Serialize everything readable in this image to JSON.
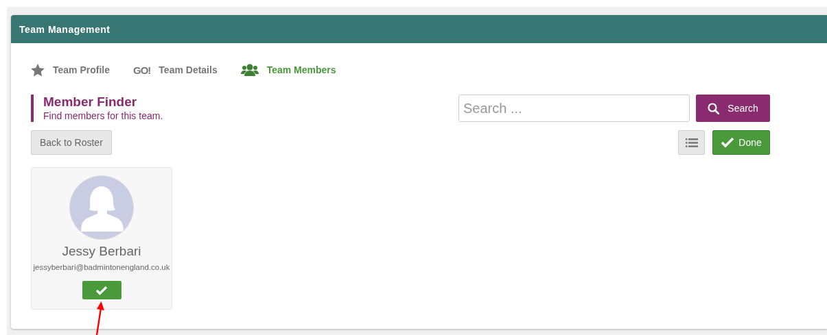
{
  "panel": {
    "title": "Team Management"
  },
  "tabs": [
    {
      "kind": "star",
      "label": "Team Profile",
      "selected": false
    },
    {
      "kind": "logo",
      "logo": "GO!",
      "label": "Team Details",
      "selected": false
    },
    {
      "kind": "people",
      "label": "Team Members",
      "selected": true
    }
  ],
  "finder": {
    "title": "Member Finder",
    "subtitle": "Find members for this team."
  },
  "search": {
    "placeholder": "Search ...",
    "button": "Search"
  },
  "back_button": "Back to Roster",
  "done_button": "Done",
  "members": [
    {
      "name": "Jessy Berbari",
      "email": "jessyberbari@badmintonengland.co.uk",
      "selected": true
    }
  ]
}
